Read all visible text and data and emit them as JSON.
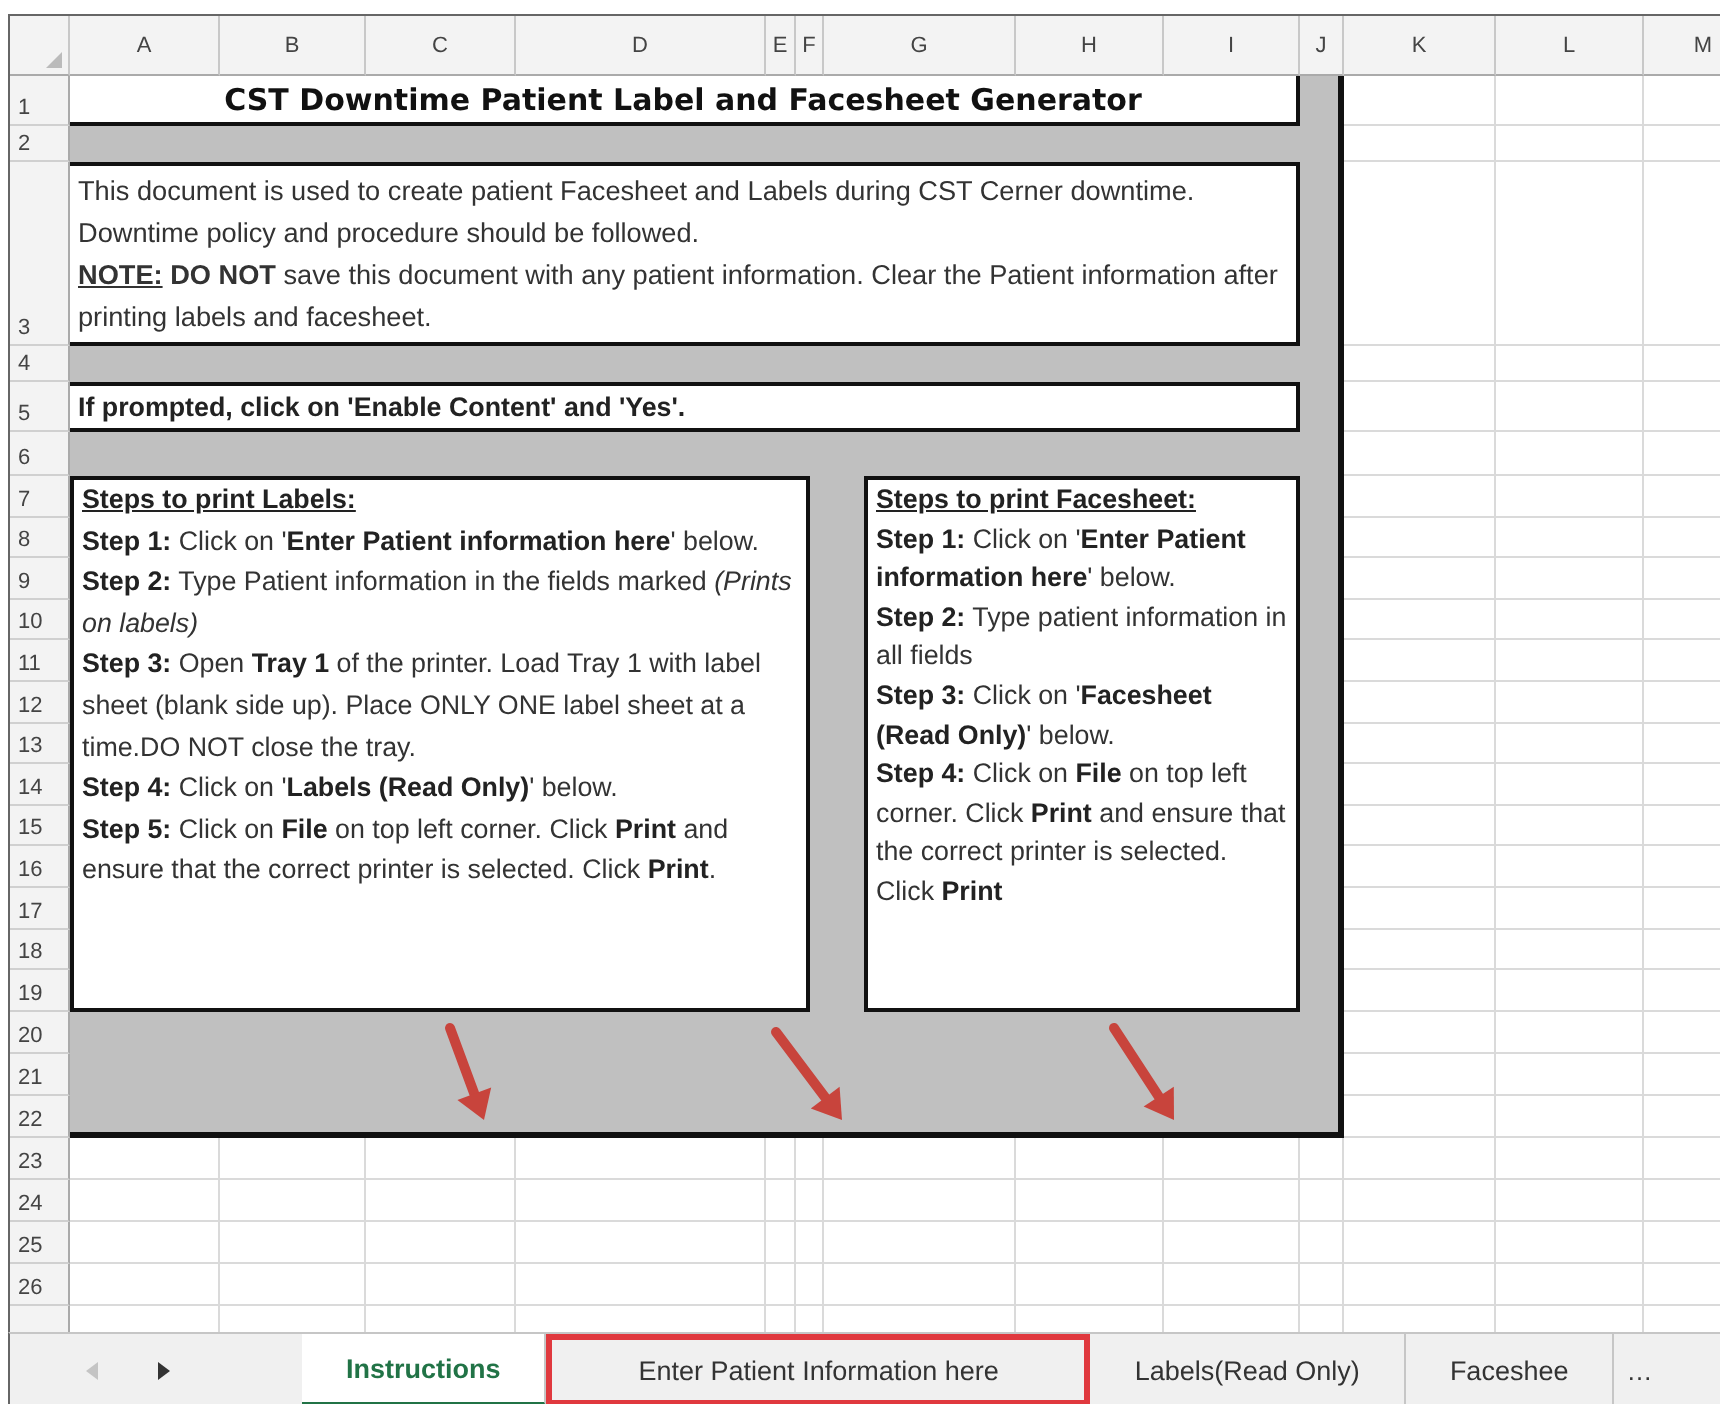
{
  "column_headers": [
    "A",
    "B",
    "C",
    "D",
    "E",
    "F",
    "G",
    "H",
    "I",
    "J",
    "K",
    "L",
    "M"
  ],
  "row_numbers": [
    "1",
    "2",
    "3",
    "4",
    "5",
    "6",
    "7",
    "8",
    "9",
    "10",
    "11",
    "12",
    "13",
    "14",
    "15",
    "16",
    "17",
    "18",
    "19",
    "20",
    "21",
    "22",
    "23",
    "24",
    "25",
    "26"
  ],
  "title": "CST Downtime Patient Label and Facesheet Generator",
  "intro": {
    "text": "This document is used to create patient Facesheet and Labels during CST Cerner downtime. Downtime policy and procedure should be followed.",
    "note_label": "NOTE:",
    "note": "**DO NOT** save this document with any patient information. Clear the Patient information after printing labels and facesheet."
  },
  "prompt": "If prompted, click on 'Enable Content' and 'Yes'.",
  "step_boxes": [
    {
      "heading": "Steps to print Labels:",
      "steps": [
        "**Step 1:** Click on '**Enter Patient information here**' below.",
        "**Step 2:** Type Patient information in the fields marked *(Prints on labels)*",
        "**Step 3:** Open **Tray 1** of the printer. Load Tray 1 with label sheet (blank side up). Place ONLY ONE label sheet at a time.DO NOT close the tray.",
        "**Step 4:** Click on '**Labels (Read Only)**' below.",
        "**Step 5:** Click on **File** on top left corner. Click **Print** and ensure that the correct printer is selected. Click **Print**."
      ]
    },
    {
      "heading": "Steps to print Facesheet:",
      "steps": [
        "**Step 1:** Click on '**Enter Patient information here**' below.",
        "**Step 2:** Type patient information in all fields",
        "**Step 3:** Click on '**Facesheet (Read Only)**' below.",
        "**Step 4:** Click on **File** on top left corner. Click **Print** and ensure that the correct printer is selected. Click **Print**"
      ]
    }
  ],
  "sheet_nav": [
    {
      "kind": "prev",
      "disabled": true
    },
    {
      "kind": "next",
      "disabled": false
    }
  ],
  "tabs": [
    {
      "label": "Instructions",
      "selected": true,
      "highlighted": false
    },
    {
      "label": "Enter Patient Information here",
      "selected": false,
      "highlighted": true
    },
    {
      "label": "Labels(Read Only)",
      "selected": false,
      "highlighted": false
    },
    {
      "label": "Faceshee",
      "selected": false,
      "highlighted": false
    }
  ],
  "tab_overflow": "…"
}
